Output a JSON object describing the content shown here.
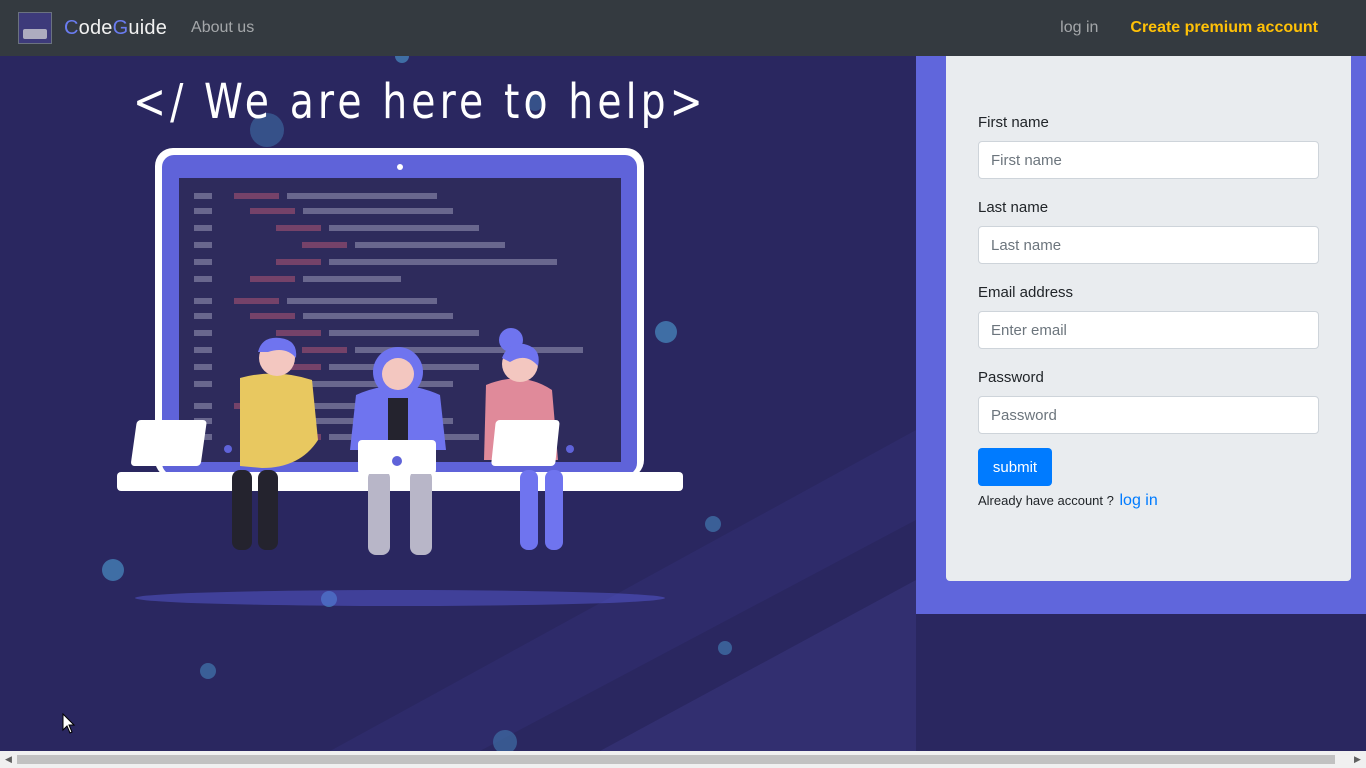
{
  "navbar": {
    "brand_first": "C",
    "brand_mid": "ode",
    "brand_accent2": "G",
    "brand_rest": "uide",
    "about_label": "About us",
    "login_label": "log in",
    "premium_label": "Create premium account",
    "premium_color": "#ffc107"
  },
  "hero": {
    "title": "</ We are here to help>"
  },
  "form": {
    "first_name_label": "First name",
    "first_name_placeholder": "First name",
    "last_name_label": "Last name",
    "last_name_placeholder": "Last name",
    "email_label": "Email address",
    "email_placeholder": "Enter email",
    "password_label": "Password",
    "password_placeholder": "Password",
    "submit_label": "submit",
    "already_text": "Already have account ?",
    "login_link_label": "log in"
  },
  "colors": {
    "background": "#2a2760",
    "panel": "#6066dc",
    "card": "#e9ecef",
    "primary_button": "#007bff"
  }
}
